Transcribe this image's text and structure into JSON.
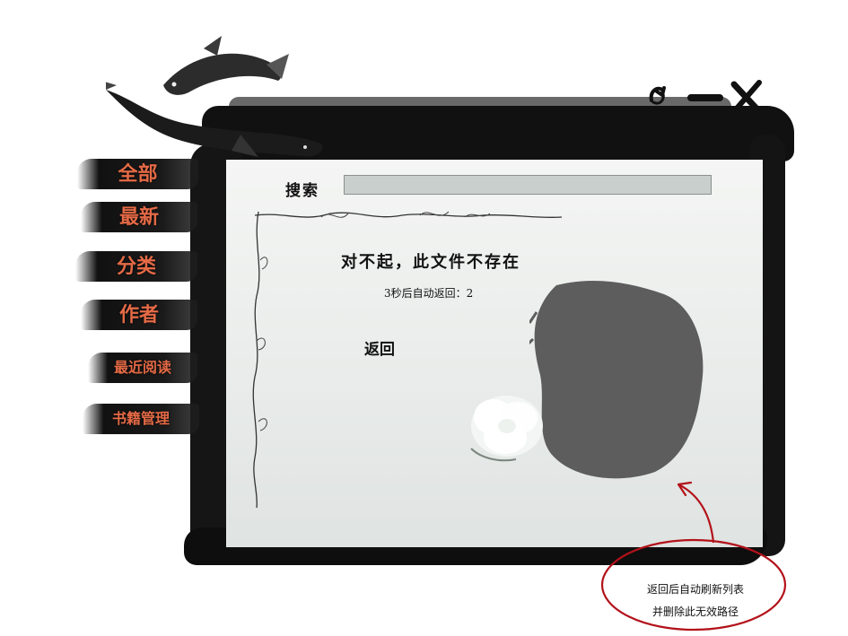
{
  "sidebar": {
    "items": [
      {
        "label": "全部"
      },
      {
        "label": "最新"
      },
      {
        "label": "分类"
      },
      {
        "label": "作者"
      },
      {
        "label": "最近阅读"
      },
      {
        "label": "书籍管理"
      }
    ]
  },
  "search": {
    "label": "搜索",
    "value": "",
    "placeholder": ""
  },
  "main": {
    "error_message": "对不起，此文件不存在",
    "countdown": "3秒后自动返回：2",
    "back_label": "返回"
  },
  "annotation": {
    "line1": "返回后自动刷新列表",
    "line2": "并删除此无效路径"
  },
  "colors": {
    "nav_text": "#e46a46",
    "ink": "#111111",
    "annotation": "#b3121a"
  },
  "icons": [
    "refresh-icon",
    "minimize-icon",
    "close-icon",
    "koi-fish-decoration",
    "white-flower-decoration",
    "ink-blot-decoration"
  ]
}
